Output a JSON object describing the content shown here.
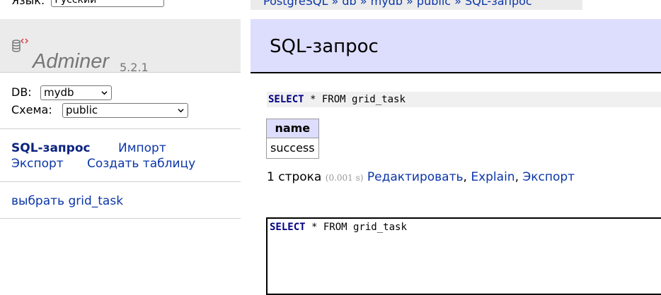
{
  "language": {
    "label": "Язык:",
    "selected": "Русский"
  },
  "logo": {
    "name": "Adminer",
    "version": "5.2.1"
  },
  "db_selector": {
    "db_label": "DB:",
    "db_value": "mydb",
    "schema_label": "Схема:",
    "schema_value": "public"
  },
  "nav": {
    "sql_query": "SQL-запрос",
    "import": "Импорт",
    "export": "Экспорт",
    "create_table": "Создать таблицу"
  },
  "tables": [
    "выбрать grid_task"
  ],
  "breadcrumb": "PostgreSQL  »  db  »  mydb  »  public  »  SQL-запрос",
  "page_title": "SQL-запрос",
  "query": {
    "keyword": "SELECT",
    "rest": " * FROM grid_task"
  },
  "result": {
    "columns": [
      "name"
    ],
    "rows": [
      [
        "success"
      ]
    ],
    "row_count": "1 строка",
    "time": "(0.001 s)",
    "links": {
      "edit": "Редактировать",
      "explain": "Explain",
      "export": "Экспорт"
    }
  },
  "editor": {
    "keyword": "SELECT",
    "rest": " * FROM grid_task"
  },
  "colors": {
    "header_bg": "#ddddfd",
    "link": "#0b36a8",
    "sidebar_bg": "#ebebeb"
  }
}
